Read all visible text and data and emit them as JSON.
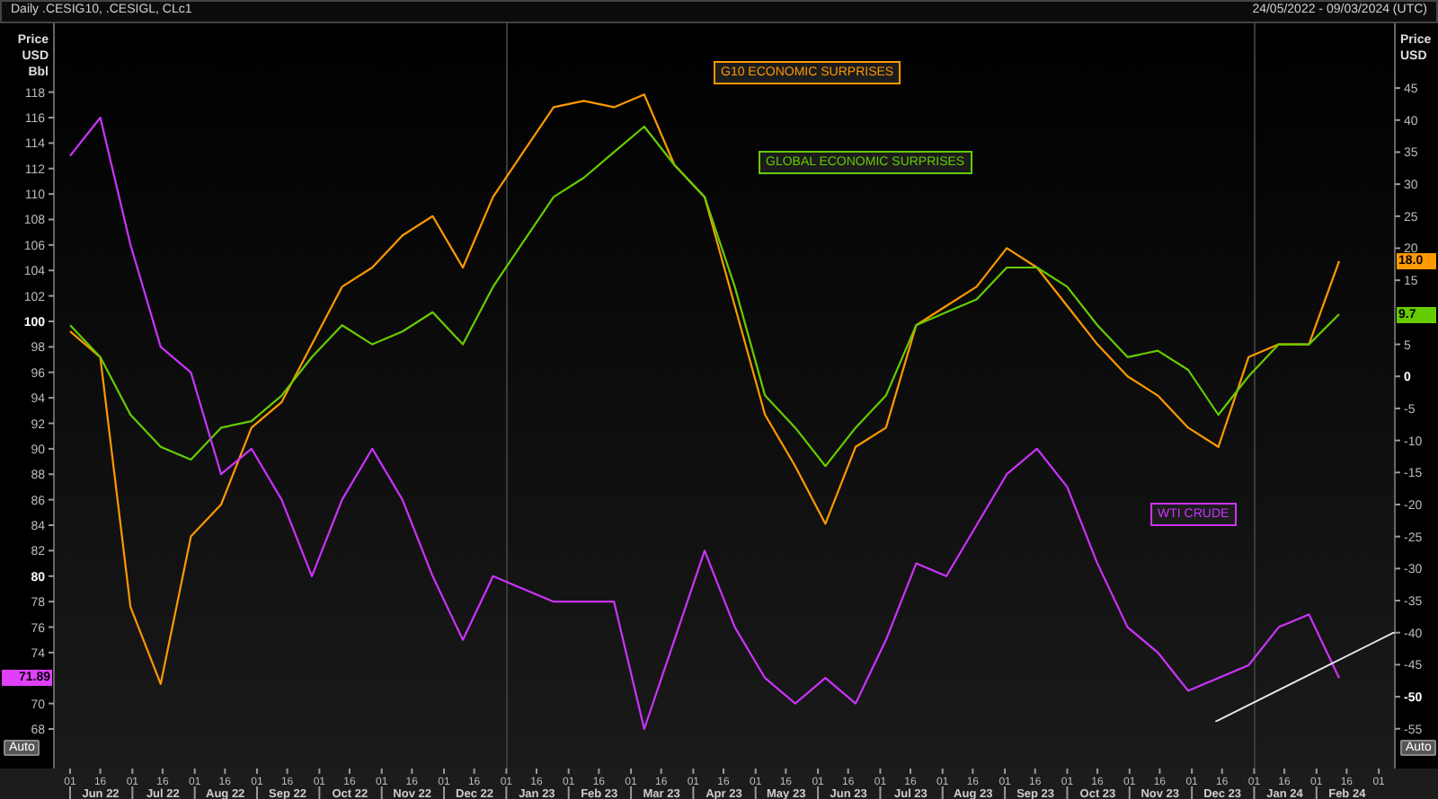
{
  "header": {
    "title": "Daily .CESIG10, .CESIGL, CLc1",
    "date_range": "24/05/2022 - 09/03/2024 (UTC)"
  },
  "left_axis": {
    "unit_lines": [
      "Price",
      "USD",
      "Bbl"
    ],
    "ticks": [
      {
        "label": "118",
        "bold": false
      },
      {
        "label": "116",
        "bold": false
      },
      {
        "label": "114",
        "bold": false
      },
      {
        "label": "112",
        "bold": false
      },
      {
        "label": "110",
        "bold": false
      },
      {
        "label": "108",
        "bold": false
      },
      {
        "label": "106",
        "bold": false
      },
      {
        "label": "104",
        "bold": false
      },
      {
        "label": "102",
        "bold": false
      },
      {
        "label": "100",
        "bold": true
      },
      {
        "label": "98",
        "bold": false
      },
      {
        "label": "96",
        "bold": false
      },
      {
        "label": "94",
        "bold": false
      },
      {
        "label": "92",
        "bold": false
      },
      {
        "label": "90",
        "bold": false
      },
      {
        "label": "88",
        "bold": false
      },
      {
        "label": "86",
        "bold": false
      },
      {
        "label": "84",
        "bold": false
      },
      {
        "label": "82",
        "bold": false
      },
      {
        "label": "80",
        "bold": true
      },
      {
        "label": "78",
        "bold": false
      },
      {
        "label": "76",
        "bold": false
      },
      {
        "label": "74",
        "bold": false
      },
      {
        "label": "70",
        "bold": false
      },
      {
        "label": "68",
        "bold": false
      }
    ],
    "auto_button": "Auto"
  },
  "right_axis": {
    "unit_lines": [
      "Price",
      "USD"
    ],
    "ticks": [
      {
        "label": "45",
        "bold": false
      },
      {
        "label": "40",
        "bold": false
      },
      {
        "label": "35",
        "bold": false
      },
      {
        "label": "30",
        "bold": false
      },
      {
        "label": "25",
        "bold": false
      },
      {
        "label": "20",
        "bold": false
      },
      {
        "label": "15",
        "bold": false
      },
      {
        "label": "5",
        "bold": false
      },
      {
        "label": "0",
        "bold": true
      },
      {
        "label": "-5",
        "bold": false
      },
      {
        "label": "-10",
        "bold": false
      },
      {
        "label": "-15",
        "bold": false
      },
      {
        "label": "-20",
        "bold": false
      },
      {
        "label": "-25",
        "bold": false
      },
      {
        "label": "-30",
        "bold": false
      },
      {
        "label": "-35",
        "bold": false
      },
      {
        "label": "-40",
        "bold": false
      },
      {
        "label": "-45",
        "bold": false
      },
      {
        "label": "-50",
        "bold": true
      },
      {
        "label": "-55",
        "bold": false
      }
    ],
    "auto_button": "Auto"
  },
  "x_axis": {
    "day_ticks": [
      "01",
      "16",
      "01",
      "16",
      "01",
      "16",
      "01",
      "16",
      "01",
      "16",
      "01",
      "16",
      "01",
      "16",
      "01",
      "16",
      "01",
      "16",
      "01",
      "16",
      "01",
      "16",
      "01",
      "16",
      "01",
      "16",
      "01",
      "16",
      "01",
      "16",
      "01",
      "16",
      "01",
      "16",
      "01",
      "16",
      "01",
      "16",
      "01",
      "16",
      "01",
      "16",
      "01"
    ],
    "months": [
      "Jun 22",
      "Jul 22",
      "Aug 22",
      "Sep 22",
      "Oct 22",
      "Nov 22",
      "Dec 22",
      "Jan 23",
      "Feb 23",
      "Mar 23",
      "Apr 23",
      "May 23",
      "Jun 23",
      "Jul 23",
      "Aug 23",
      "Sep 23",
      "Oct 23",
      "Nov 23",
      "Dec 23",
      "Jan 24",
      "Feb 24"
    ]
  },
  "value_tags": [
    {
      "text": "18.0",
      "color": "#ff9900"
    },
    {
      "text": "9.7",
      "color": "#66cc00"
    },
    {
      "text": "71.89",
      "color": "#e040fb"
    }
  ],
  "chart_data": {
    "type": "line",
    "ylim": [
      64.9,
      123.4
    ],
    "y2lim": [
      -61.2,
      55.1
    ],
    "yticks": [
      118,
      116,
      114,
      112,
      110,
      108,
      106,
      104,
      102,
      100,
      98,
      96,
      94,
      92,
      90,
      88,
      86,
      84,
      82,
      80,
      78,
      76,
      74,
      70,
      68
    ],
    "y2ticks": [
      45,
      40,
      35,
      30,
      25,
      20,
      15,
      5,
      0,
      -5,
      -10,
      -15,
      -20,
      -25,
      -30,
      -35,
      -40,
      -45,
      -50,
      -55
    ],
    "series": [
      {
        "name": "G10 ECONOMIC SURPRISES",
        "color": "#ff9900",
        "axis": "y2",
        "values": [
          7,
          3,
          -36,
          -48,
          -25,
          -20,
          -8,
          -4,
          5,
          14,
          17,
          22,
          25,
          17,
          28,
          35,
          42,
          43,
          42,
          44,
          33,
          28,
          11,
          -6,
          -14,
          -23,
          -11,
          -8,
          8,
          11,
          14,
          20,
          17,
          11,
          5,
          0,
          -3,
          -8,
          -11,
          3,
          5,
          5,
          18
        ]
      },
      {
        "name": "GLOBAL ECONOMIC SURPRISES",
        "color": "#66cc00",
        "axis": "y2",
        "values": [
          8,
          3,
          -6,
          -11,
          -13,
          -8,
          -7,
          -3,
          3,
          8,
          5,
          7,
          10,
          5,
          14,
          21,
          28,
          31,
          35,
          39,
          33,
          28,
          14,
          -3,
          -8,
          -14,
          -8,
          -3,
          8,
          10,
          12,
          17,
          17,
          14,
          8,
          3,
          4,
          1,
          -6,
          0,
          5,
          5,
          9.7
        ]
      },
      {
        "name": "WTI CRUDE",
        "color": "#cc33ff",
        "values": [
          113,
          116,
          106,
          98,
          96,
          88,
          90,
          86,
          80,
          86,
          90,
          86,
          80,
          75,
          80,
          79,
          78,
          78,
          78,
          68,
          75,
          82,
          76,
          72,
          70,
          72,
          70,
          75,
          81,
          80,
          84,
          88,
          90,
          87,
          81,
          76,
          74,
          71,
          72,
          73,
          76,
          77,
          72
        ]
      }
    ]
  }
}
